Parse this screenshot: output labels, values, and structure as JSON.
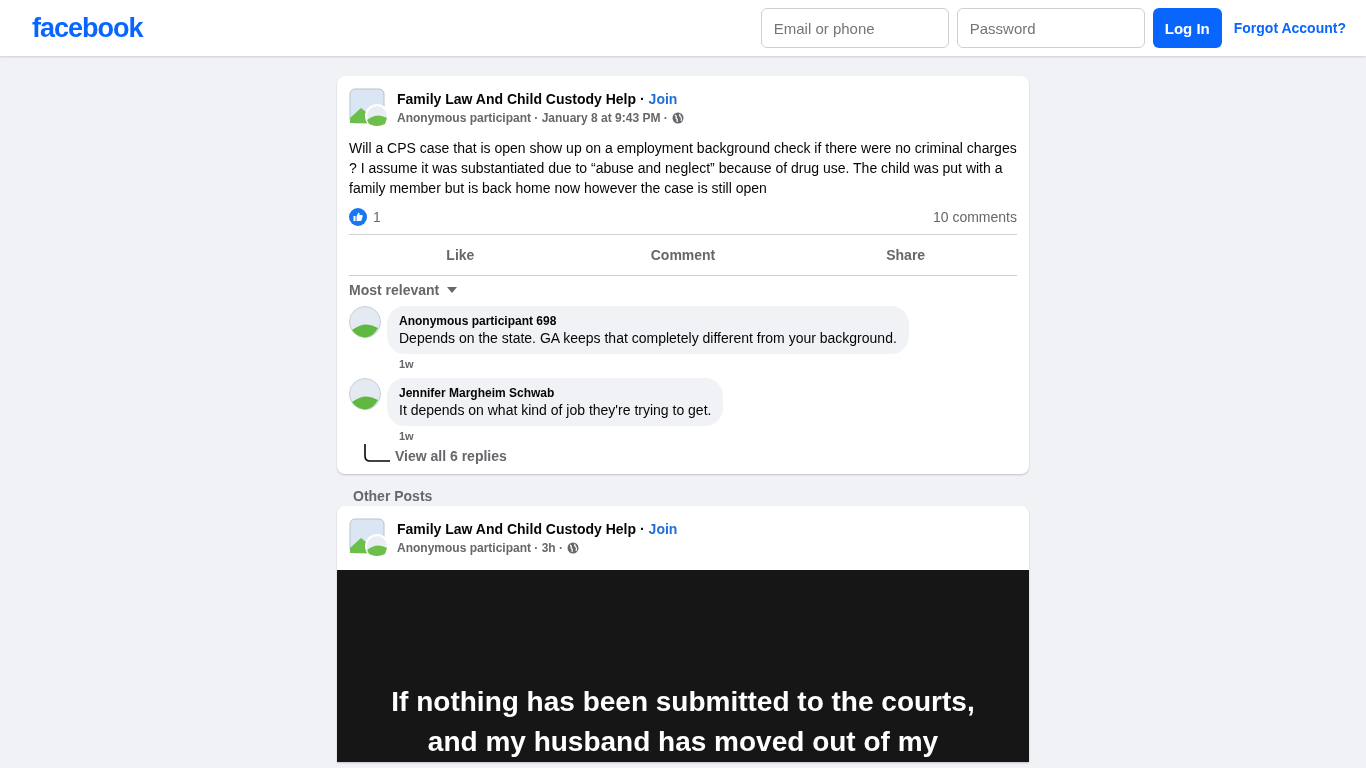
{
  "header": {
    "logo": "facebook",
    "email_placeholder": "Email or phone",
    "password_placeholder": "Password",
    "login": "Log In",
    "forgot": "Forgot Account?"
  },
  "post": {
    "group": "Family Law And Child Custody Help ·",
    "join": "Join",
    "meta": "Anonymous participant · January 8 at 9:43 PM ·",
    "body": "Will a CPS case that is open show up on a employment background check if there were no criminal charges ? I assume it was substantiated due to “abuse and neglect” because of drug use. The child was put with a family member but is back home now however the case is still open",
    "likes": "1",
    "comments_count": "10 comments",
    "actions": [
      "Like",
      "Comment",
      "Share"
    ],
    "sort": "Most relevant",
    "comments": [
      {
        "author": "Anonymous participant 698",
        "text": "Depends on the state. GA keeps that completely different from your background.",
        "time": "1w"
      },
      {
        "author": "Jennifer Margheim Schwab",
        "text": "It depends on what kind of job they're trying to get.",
        "time": "1w"
      }
    ],
    "view_replies": "View all 6 replies"
  },
  "other_posts_heading": "Other Posts",
  "other_post": {
    "group": "Family Law And Child Custody Help ·",
    "join": "Join",
    "meta": "Anonymous participant · 3h ·",
    "body": "If nothing has been submitted to the courts, and my husband has moved out of my"
  }
}
